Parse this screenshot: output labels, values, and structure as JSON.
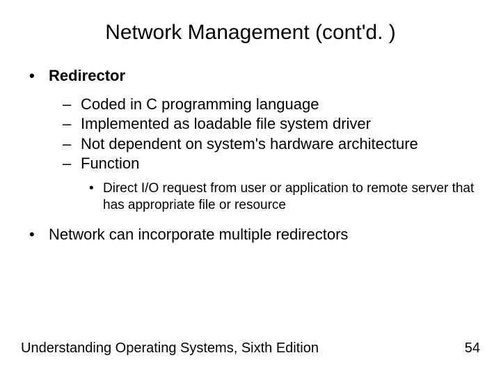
{
  "title": "Network Management (cont'd. )",
  "bullets": {
    "b1": "Redirector",
    "b1_subs": {
      "s1": "Coded in C programming language",
      "s2": "Implemented as loadable file system driver",
      "s3": "Not dependent on system's hardware architecture",
      "s4": "Function",
      "s4_subs": {
        "t1": "Direct I/O request from user or application to remote server that has appropriate file or resource"
      }
    },
    "b2": "Network can incorporate multiple redirectors"
  },
  "markers": {
    "l1": "•",
    "l2": "–",
    "l3": "•"
  },
  "footer": {
    "left": "Understanding Operating Systems, Sixth Edition",
    "right": "54"
  }
}
